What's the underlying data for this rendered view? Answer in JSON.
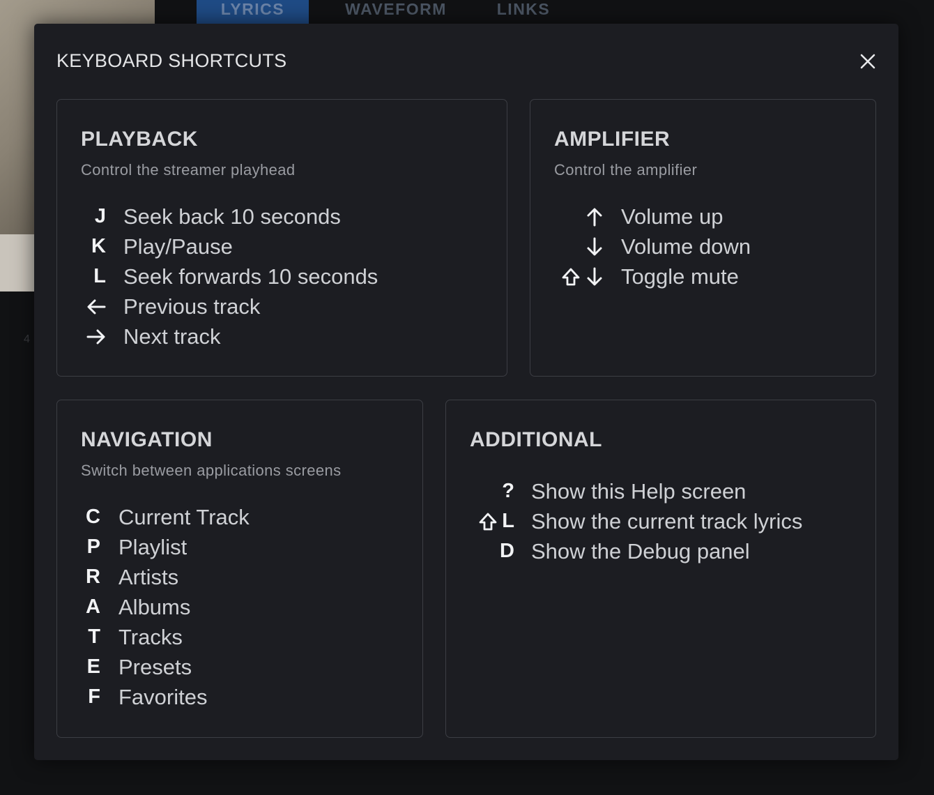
{
  "tabs": [
    {
      "label": "LYRICS",
      "active": true
    },
    {
      "label": "WAVEFORM",
      "active": false
    },
    {
      "label": "LINKS",
      "active": false
    }
  ],
  "background": {
    "partial_text": "4"
  },
  "modal": {
    "title": "KEYBOARD SHORTCUTS",
    "close_icon": "close-icon"
  },
  "sections": {
    "playback": {
      "title": "PLAYBACK",
      "subtitle": "Control the streamer playhead",
      "shortcuts": [
        {
          "key": "J",
          "label": "Seek back 10 seconds"
        },
        {
          "key": "K",
          "label": "Play/Pause"
        },
        {
          "key": "L",
          "label": "Seek forwards 10 seconds"
        },
        {
          "key_icon": "arrow-left-icon",
          "label": "Previous track"
        },
        {
          "key_icon": "arrow-right-icon",
          "label": "Next track"
        }
      ]
    },
    "amplifier": {
      "title": "AMPLIFIER",
      "subtitle": "Control the amplifier",
      "shortcuts": [
        {
          "key_icon": "arrow-up-icon",
          "label": "Volume up"
        },
        {
          "key_icon": "arrow-down-icon",
          "label": "Volume down"
        },
        {
          "modifier_icon": "shift-icon",
          "key_icon": "arrow-down-icon",
          "label": "Toggle mute"
        }
      ]
    },
    "navigation": {
      "title": "NAVIGATION",
      "subtitle": "Switch between applications screens",
      "shortcuts": [
        {
          "key": "C",
          "label": "Current Track"
        },
        {
          "key": "P",
          "label": "Playlist"
        },
        {
          "key": "R",
          "label": "Artists"
        },
        {
          "key": "A",
          "label": "Albums"
        },
        {
          "key": "T",
          "label": "Tracks"
        },
        {
          "key": "E",
          "label": "Presets"
        },
        {
          "key": "F",
          "label": "Favorites"
        }
      ]
    },
    "additional": {
      "title": "ADDITIONAL",
      "shortcuts": [
        {
          "key": "?",
          "label": "Show this Help screen"
        },
        {
          "modifier_icon": "shift-icon",
          "key": "L",
          "label": "Show the current track lyrics"
        },
        {
          "key": "D",
          "label": "Show the Debug panel"
        }
      ]
    }
  }
}
